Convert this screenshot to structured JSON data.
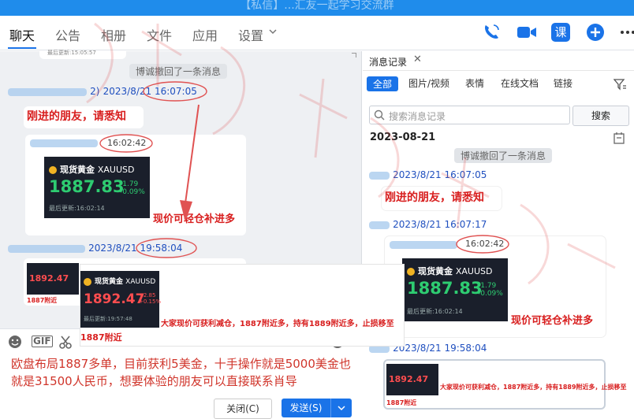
{
  "titlebar": {
    "title": "【私信】...汇友一起学习交流群"
  },
  "nav": {
    "tabs": [
      "聊天",
      "公告",
      "相册",
      "文件",
      "应用",
      "设置"
    ],
    "course_icon_label": "课"
  },
  "chat": {
    "top_snippet": "最后更新:15:05:57",
    "recall_notice": "博诚撤回了一条消息",
    "msg1_sender_tail": "2)",
    "msg1_time": "2023/8/21 16:07:05",
    "msg1_text": "刚进的朋友，请悉知",
    "msg2_time": "16:02:42",
    "msg2_caption": "现价可轻仓补进多",
    "msg3_time": "2023/8/21 19:58:04",
    "card_small_label": "1887附近"
  },
  "gold_card": {
    "name": "现货黄金",
    "symbol": "XAUUSD",
    "price": "1887.83",
    "change": "-1.79",
    "change_pct": "-0.09%",
    "updated": "最后更新:16:02:14"
  },
  "gold_card_up": {
    "name": "现货黄金",
    "symbol": "XAUUSD",
    "price": "1892.47",
    "change": "+2.85",
    "change_pct": "+0.15%",
    "updated": "最后更新:19:57:48",
    "label": "1887附近"
  },
  "overlay": {
    "caption": "大家现价可获利减仓，1887附近多，持有1889附近多，止损移至"
  },
  "compose": {
    "message": "欧盘布局1887多单，目前获利5美金，十手操作就是5000美金也就是31500人民币，想要体验的朋友可以直接联系肖导",
    "close_label": "关闭(C)",
    "send_label": "发送(S)"
  },
  "history": {
    "title": "消息记录",
    "filters": [
      "全部",
      "图片/视频",
      "表情",
      "在线文档",
      "链接"
    ],
    "search_placeholder": "搜索消息记录",
    "search_button": "搜索",
    "date": "2023-08-21",
    "recall_notice": "博诚撤回了一条消息",
    "msg1_time": "2023/8/21 16:07:05",
    "msg1_text": "刚进的朋友，请悉知",
    "msg2_time": "2023/8/21 16:07:17",
    "msg2_inner_time": "16:02:42",
    "msg2_caption": "现价可轻仓补进多",
    "msg3_time": "2023/8/21 19:58:04",
    "msg3_caption": "大家现价可获利减仓，1887附近多，持有1889附近多，止损移至",
    "msg3_label": "1887附近"
  },
  "colors": {
    "accent": "#1a73e8",
    "watermark": "#e05252",
    "highlight_red": "#d81e1e",
    "gain_green": "#2ecc71",
    "loss_red": "#ff4d4f"
  }
}
